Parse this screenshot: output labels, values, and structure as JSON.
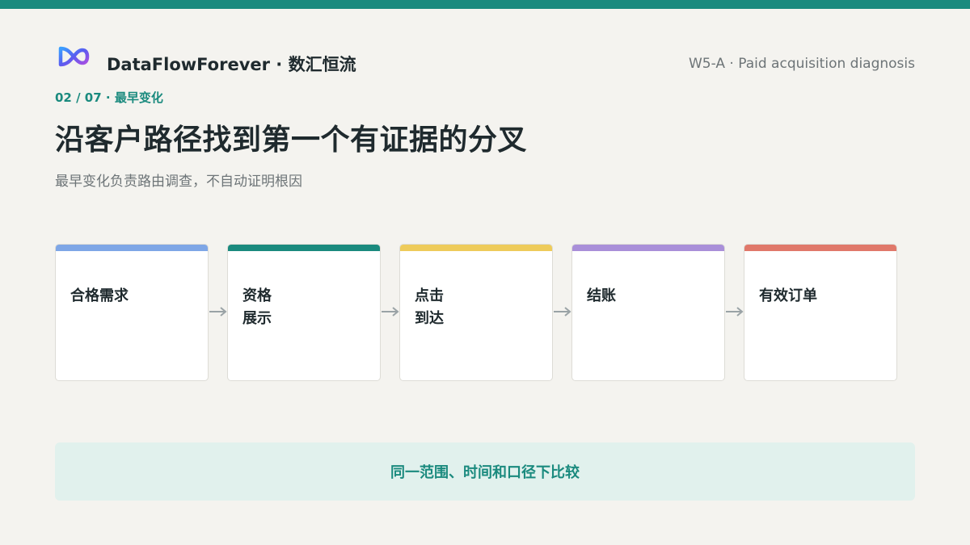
{
  "header": {
    "brand": "DataFlowForever · 数汇恒流",
    "doc_tag": "W5-A · Paid acquisition diagnosis"
  },
  "slide": {
    "kicker": "02 / 07 · 最早变化",
    "title": "沿客户路径找到第一个有证据的分叉",
    "subtitle": "最早变化负责路由调查，不自动证明根因"
  },
  "flow": {
    "steps": [
      {
        "label": "合格需求",
        "color": "#7ea6e6"
      },
      {
        "label": "资格\n展示",
        "color": "#1a8a7e"
      },
      {
        "label": "点击\n到达",
        "color": "#eecb5a"
      },
      {
        "label": "结账",
        "color": "#a98fd9"
      },
      {
        "label": "有效订单",
        "color": "#e0786a"
      }
    ]
  },
  "callout": {
    "text": "同一范围、时间和口径下比较"
  },
  "colors": {
    "accent": "#1a8a7e",
    "background": "#f4f3ef",
    "arrow": "#9aa3a6"
  }
}
